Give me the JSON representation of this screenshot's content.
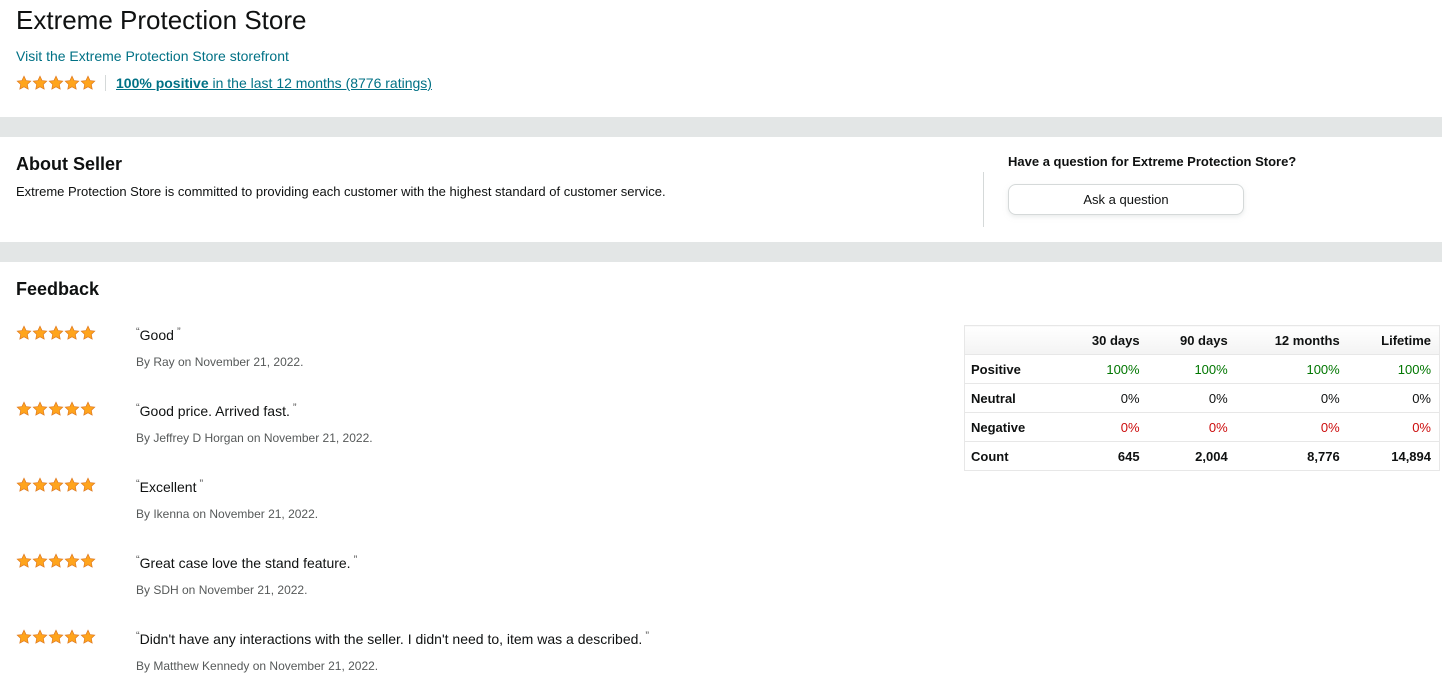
{
  "store": {
    "title": "Extreme Protection Store",
    "storefront_link": "Visit the Extreme Protection Store storefront",
    "rating_stars": 5,
    "rating_positive": "100% positive",
    "rating_rest": " in the last 12 months (8776 ratings)"
  },
  "about": {
    "title": "About Seller",
    "text": "Extreme Protection Store is committed to providing each customer with the highest standard of customer service."
  },
  "question": {
    "title": "Have a question for Extreme Protection Store?",
    "button_label": "Ask a question"
  },
  "feedback": {
    "title": "Feedback",
    "reviews": [
      {
        "stars": 5,
        "quote": "Good",
        "author": "By Ray on November 21, 2022."
      },
      {
        "stars": 5,
        "quote": "Good price. Arrived fast.",
        "author": "By Jeffrey D Horgan on November 21, 2022."
      },
      {
        "stars": 5,
        "quote": "Excellent",
        "author": "By Ikenna on November 21, 2022."
      },
      {
        "stars": 5,
        "quote": "Great case love the stand feature.",
        "author": "By SDH on November 21, 2022."
      },
      {
        "stars": 5,
        "quote": "Didn't have any interactions with the seller. I didn't need to, item was a described.",
        "author": "By Matthew Kennedy on November 21, 2022."
      }
    ]
  },
  "stats": {
    "headers": [
      "",
      "30 days",
      "90 days",
      "12 months",
      "Lifetime"
    ],
    "rows": [
      {
        "label": "Positive",
        "values": [
          "100%",
          "100%",
          "100%",
          "100%"
        ]
      },
      {
        "label": "Neutral",
        "values": [
          "0%",
          "0%",
          "0%",
          "0%"
        ]
      },
      {
        "label": "Negative",
        "values": [
          "0%",
          "0%",
          "0%",
          "0%"
        ]
      },
      {
        "label": "Count",
        "values": [
          "645",
          "2,004",
          "8,776",
          "14,894"
        ]
      }
    ]
  },
  "colors": {
    "link": "#007185",
    "star": "#ffa41c",
    "positive": "#007600",
    "negative": "#cc0c0c",
    "band": "#e3e6e6"
  }
}
